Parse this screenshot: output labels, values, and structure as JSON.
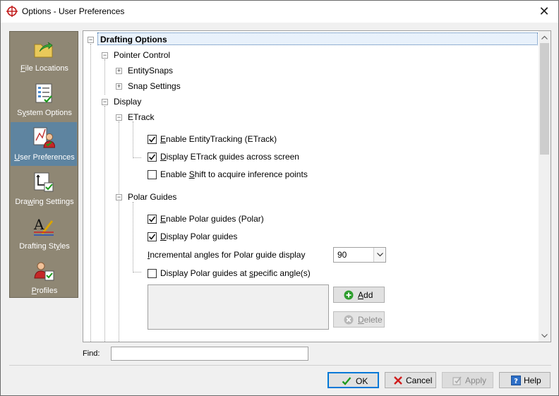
{
  "window": {
    "title": "Options - User Preferences",
    "close_glyph": "✕"
  },
  "nav": {
    "items": [
      {
        "key": "file-locations",
        "prefix": "",
        "accel": "F",
        "rest": "ile Locations",
        "icon": "folder-arrow-icon"
      },
      {
        "key": "system-options",
        "prefix": "S",
        "accel": "y",
        "rest": "stem Options",
        "icon": "system-checklist-icon"
      },
      {
        "key": "user-preferences",
        "prefix": "",
        "accel": "U",
        "rest": "ser Preferences",
        "icon": "user-preferences-icon",
        "selected": true
      },
      {
        "key": "drawing-settings",
        "prefix": "Dra",
        "accel": "w",
        "rest": "ing Settings",
        "icon": "drawing-settings-icon"
      },
      {
        "key": "drafting-styles",
        "prefix": "Drafting St",
        "accel": "y",
        "rest": "les",
        "icon": "drafting-styles-icon"
      },
      {
        "key": "profiles",
        "prefix": "",
        "accel": "P",
        "rest": "rofiles",
        "icon": "profiles-icon"
      }
    ],
    "selected_bg": "#5e84a0",
    "bg": "#8f8774"
  },
  "tree": {
    "drafting_options": "Drafting Options",
    "pointer_control": "Pointer Control",
    "entitysnaps": "EntitySnaps",
    "snap_settings": "Snap Settings",
    "display": "Display",
    "etrack": "ETrack",
    "enable_entitytracking": {
      "pre": "",
      "accel": "E",
      "post": "nable EntityTracking (ETrack)",
      "checked": true
    },
    "display_etrack_guides": {
      "pre": "",
      "accel": "D",
      "post": "isplay ETrack guides across screen",
      "checked": true
    },
    "enable_shift": {
      "pre": "Enable ",
      "accel": "S",
      "post": "hift to acquire inference points",
      "checked": false
    },
    "polar_guides": "Polar Guides",
    "enable_polar": {
      "pre": "",
      "accel": "E",
      "post": "nable Polar guides (Polar)",
      "checked": true
    },
    "display_polar": {
      "pre": "",
      "accel": "D",
      "post": "isplay Polar guides",
      "checked": true
    },
    "incremental_angles": {
      "pre": "",
      "accel": "I",
      "post": "ncremental angles for Polar guide display"
    },
    "incremental_value": "90",
    "display_polar_specific": {
      "pre": "Display Polar guides at ",
      "accel": "s",
      "post": "pecific angle(s)",
      "checked": false
    },
    "add_button": {
      "accel": "A",
      "rest": "dd"
    },
    "delete_button": {
      "accel": "D",
      "rest": "elete"
    }
  },
  "find": {
    "label": "Find:",
    "value": ""
  },
  "footer": {
    "ok": "OK",
    "cancel": "Cancel",
    "apply": "Apply",
    "help": "Help"
  }
}
